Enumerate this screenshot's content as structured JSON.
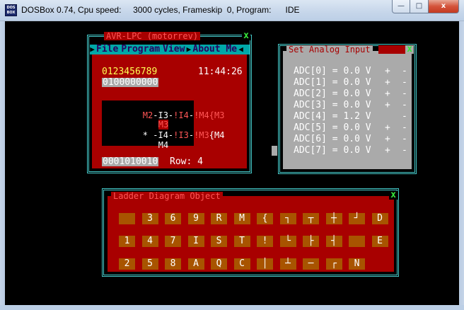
{
  "window": {
    "title": "DOSBox 0.74, Cpu speed:     3000 cycles, Frameskip  0, Program:      IDE",
    "icon_text": "DOS BOX",
    "controls": {
      "minimize": "—",
      "maximize": "□",
      "close": "x"
    }
  },
  "avr_window": {
    "title": "AVR-LPC (motorrev)",
    "close": "x",
    "menu": [
      {
        "label": "File"
      },
      {
        "label": "Program"
      },
      {
        "label": "View"
      },
      {
        "label": "About Me"
      }
    ],
    "digits": "0123456789",
    "clock": "11:44:26",
    "bits_top": "0100000000",
    "ladder_lines": [
      [
        "M2",
        "-I3-",
        "!I4",
        "-",
        "!M4",
        "{M3"
      ],
      [
        "",
        "",
        "M3",
        "",
        "",
        ""
      ],
      [
        "* ",
        "-I4-",
        "!I3",
        "-",
        "!M3",
        "{M4"
      ],
      [
        "",
        "",
        "M4",
        "",
        "",
        ""
      ]
    ],
    "bits_bottom": "0001010010",
    "row_label": "Row: 4"
  },
  "analog_window": {
    "title": "Set Analog Input",
    "close": "x",
    "rows": [
      {
        "label": "ADC[0] = 0.0 V",
        "plus": "+",
        "minus": "-"
      },
      {
        "label": "ADC[1] = 0.0 V",
        "plus": "+",
        "minus": "-"
      },
      {
        "label": "ADC[2] = 0.0 V",
        "plus": "+",
        "minus": "-"
      },
      {
        "label": "ADC[3] = 0.0 V",
        "plus": "+",
        "minus": "-"
      },
      {
        "label": "ADC[4] = 1.2 V",
        "plus": "",
        "minus": "-"
      },
      {
        "label": "ADC[5] = 0.0 V",
        "plus": "+",
        "minus": "-"
      },
      {
        "label": "ADC[6] = 0.0 V",
        "plus": "+",
        "minus": "-"
      },
      {
        "label": "ADC[7] = 0.0 V",
        "plus": "+",
        "minus": "-"
      }
    ]
  },
  "ladder_object_window": {
    "title": "Ladder Diagram Object",
    "close": "x",
    "rows": [
      [
        "",
        "3",
        "6",
        "9",
        "R",
        "M",
        "{",
        "┐",
        "┬",
        "┼",
        "┘",
        "D"
      ],
      [
        "1",
        "4",
        "7",
        "I",
        "S",
        "T",
        "!",
        "└",
        "├",
        "┤",
        "",
        "E"
      ],
      [
        "2",
        "5",
        "8",
        "A",
        "Q",
        "C",
        "│",
        "┴",
        "─",
        "┌",
        "N",
        ""
      ]
    ]
  }
}
